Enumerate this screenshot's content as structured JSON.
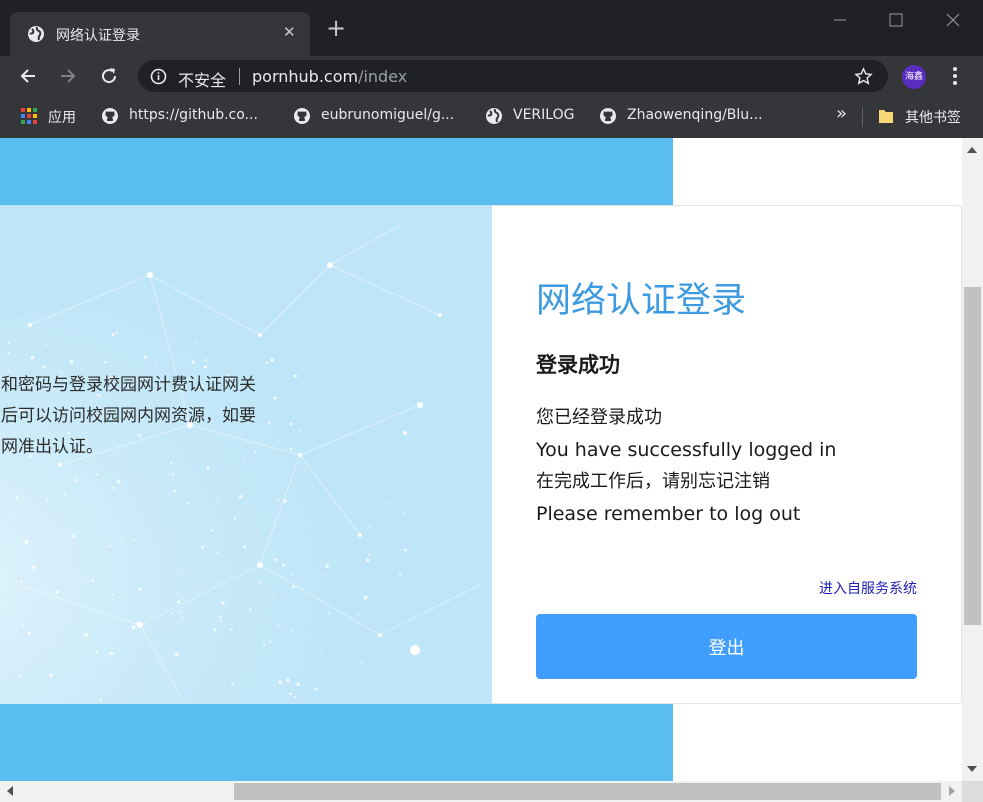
{
  "browser": {
    "tab_title": "网络认证登录",
    "security_label": "不安全",
    "url_host": "pornhub.com",
    "url_path": "/index",
    "avatar_text": "海鑫"
  },
  "bookmarks": [
    {
      "label": "应用",
      "icon": "apps-grid-icon"
    },
    {
      "label": "https://github.co...",
      "icon": "github-icon"
    },
    {
      "label": "eubrunomiguel/g...",
      "icon": "github-icon"
    },
    {
      "label": "VERILOG",
      "icon": "globe-icon"
    },
    {
      "label": "Zhaowenqing/Blu...",
      "icon": "github-icon"
    }
  ],
  "bookmarks_more": "»",
  "other_bookmarks": "其他书签",
  "page": {
    "intro_lines": [
      "名和密码与登录校园网计费认证网关",
      "以后可以访问校园网内网资源，如要",
      "园网准出认证。"
    ],
    "form_title": "网络认证登录",
    "status_title": "登录成功",
    "messages": [
      "您已经登录成功",
      "You have successfully logged in",
      "在完成工作后，请别忘记注销",
      "Please remember to log out"
    ],
    "self_service_link": "进入自服务系统",
    "logout_button": "登出"
  },
  "colors": {
    "accent": "#409eff",
    "title_blue": "#3c9be0",
    "background_blue": "#59bdf0",
    "link": "#1f1fb6"
  }
}
